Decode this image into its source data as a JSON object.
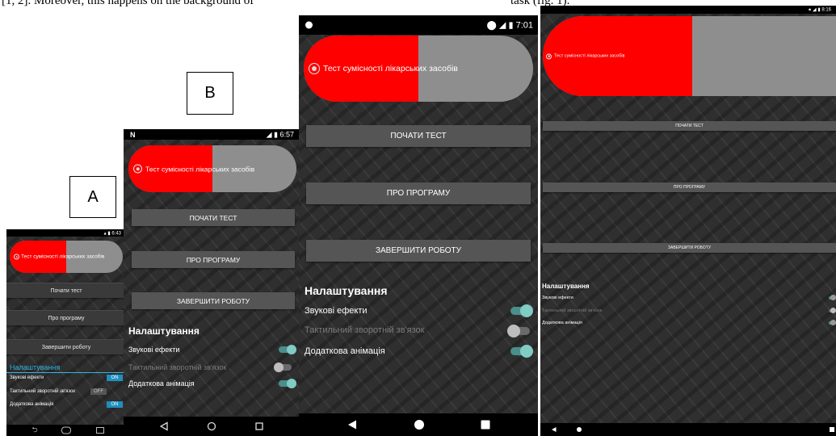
{
  "caption": {
    "left": "[1, 2]. Moreover, this happens on the background of",
    "right": "task (fig. 1)."
  },
  "labels": {
    "a": "A",
    "b": "B"
  },
  "app": {
    "title": "Тест сумісності лікарських засобів",
    "start_button": "ПОЧАТИ ТЕСТ",
    "about_button": "ПРО ПРОГРАМУ",
    "exit_button": "ЗАВЕРШИТИ РОБОТУ",
    "settings_title": "Налаштування",
    "sound_effects": "Звукові ефекти",
    "haptic_feedback": "Тактильний зворотній зв'язок",
    "extra_animation": "Додаткова анімація"
  },
  "phone_a": {
    "time": "6:43",
    "start_button": "Почати тест",
    "about_button": "Про програму",
    "exit_button": "Завершити роботу",
    "switch_on": "ON",
    "switch_off": "OFF",
    "settings_color": "#33b5e5"
  },
  "phone_b": {
    "time": "6:57"
  },
  "phone_c": {
    "time": "7:01"
  },
  "phone_d": {
    "time": "8:16"
  },
  "colors": {
    "pill_red": "#ff0000",
    "pill_gray": "#8e8e8e",
    "switch_on": "#80cbc4",
    "button": "#555555",
    "background": "#2f2f2f"
  }
}
